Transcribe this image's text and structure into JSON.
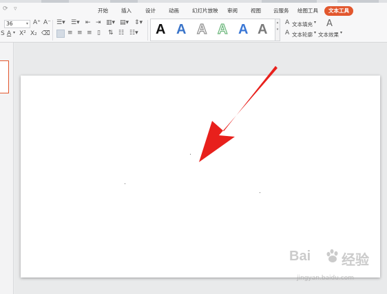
{
  "quick_access": {
    "undo": "⟳",
    "more": "▿"
  },
  "tabs": [
    {
      "label": "开始",
      "active": false
    },
    {
      "label": "插入",
      "active": false
    },
    {
      "label": "设计",
      "active": false
    },
    {
      "label": "动画",
      "active": false
    },
    {
      "label": "幻灯片放映",
      "active": false
    },
    {
      "label": "审阅",
      "active": false
    },
    {
      "label": "视图",
      "active": false
    },
    {
      "label": "云服务",
      "active": false
    },
    {
      "label": "绘图工具",
      "active": false
    },
    {
      "label": "文本工具",
      "active": true
    }
  ],
  "ribbon": {
    "font_size": "36",
    "grow_font": "A⁺",
    "shrink_font": "A⁻",
    "text_fill_label": "文本填充",
    "text_outline_label": "文本轮廓",
    "text_effect_label": "文本效果",
    "art_styles": [
      "A",
      "A",
      "A",
      "A",
      "A",
      "A"
    ]
  },
  "watermark": {
    "brand_left": "Bai",
    "brand_right": "经验",
    "url": "jingyan.baidu.com"
  },
  "colors": {
    "accent": "#e2572e",
    "arrow": "#e8201c",
    "selected_thumb_border": "#e2572e"
  }
}
